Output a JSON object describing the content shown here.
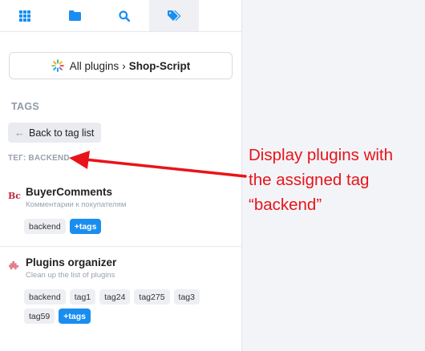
{
  "nav": {
    "items": [
      {
        "icon": "grid-icon"
      },
      {
        "icon": "folder-icon"
      },
      {
        "icon": "search-icon"
      },
      {
        "icon": "tag-icon",
        "active": true
      }
    ]
  },
  "selector": {
    "all_label": "All plugins",
    "separator": "›",
    "app_label": "Shop-Script"
  },
  "section_title": "TAGS",
  "back_label": "Back to tag list",
  "filter_label": "ТЕГ: BACKEND",
  "plugins": [
    {
      "name": "BuyerComments",
      "description": "Комментарии к покупателям",
      "icon": "buyercomments-icon",
      "tags": [
        "backend"
      ],
      "more_label": "+tags"
    },
    {
      "name": "Plugins organizer",
      "description": "Clean up the list of plugins",
      "icon": "puzzle-icon",
      "tags": [
        "backend",
        "tag1",
        "tag24",
        "tag275",
        "tag3",
        "tag59"
      ],
      "more_label": "+tags"
    }
  ],
  "annotation": {
    "line1": "Display plugins with",
    "line2": "the assigned tag",
    "line3": "“backend”"
  },
  "colors": {
    "accent": "#1a8ef0",
    "annotation": "#e8141a"
  }
}
